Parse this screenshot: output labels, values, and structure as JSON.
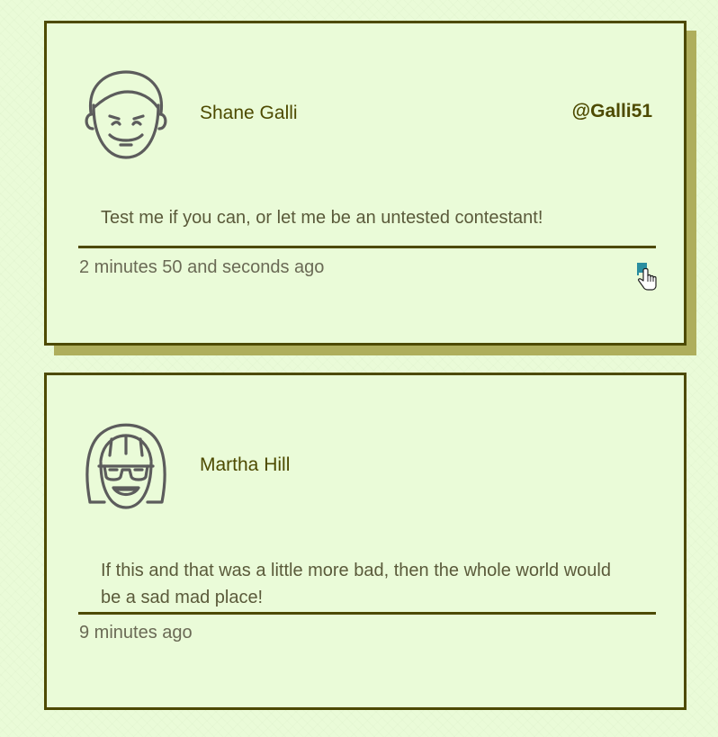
{
  "colors": {
    "accent": "#4d4a00",
    "shadow": "#aeae5c",
    "background": "#eafbd8",
    "flag": "#2b8ea0"
  },
  "comments": [
    {
      "name": "Shane Galli",
      "handle": "@Galli51",
      "text": "Test me if you can, or let me be an untested contestant!",
      "time": "2 minutes 50 and seconds ago",
      "avatar_icon": "boy-avatar-icon",
      "action_icon": "flag-icon"
    },
    {
      "name": "Martha Hill",
      "handle": "",
      "text": "If this and that was a little more bad, then the whole world would be a sad mad place!",
      "time": "9 minutes ago",
      "avatar_icon": "girl-sunglasses-avatar-icon"
    }
  ]
}
